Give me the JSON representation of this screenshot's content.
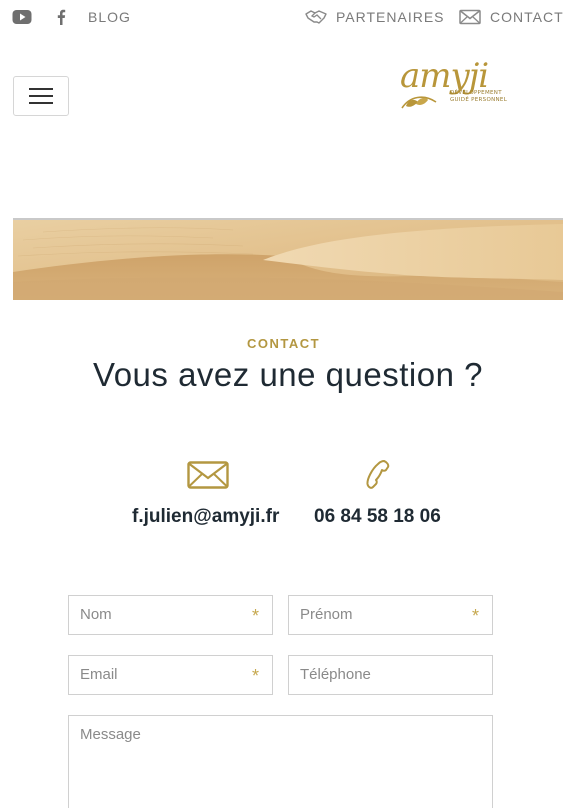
{
  "topbar": {
    "youtube_icon": "youtube-icon",
    "facebook_icon": "facebook-icon",
    "blog_label": "BLOG",
    "partners_icon": "handshake-icon",
    "partners_label": "PARTENAIRES",
    "contact_icon": "envelope-icon",
    "contact_label": "CONTACT"
  },
  "header": {
    "menu_icon": "hamburger-icon",
    "logo": {
      "word": "amyji",
      "line1": "Développement",
      "line2": "Guidé Personnel"
    }
  },
  "section": {
    "eyebrow": "CONTACT",
    "title": "Vous avez une question ?"
  },
  "contact": {
    "email": "f.julien@amyji.fr",
    "phone": "06 84 58 18 06",
    "email_icon": "envelope-icon",
    "phone_icon": "phone-icon"
  },
  "form": {
    "nom_placeholder": "Nom",
    "prenom_placeholder": "Prénom",
    "email_placeholder": "Email",
    "telephone_placeholder": "Téléphone",
    "message_placeholder": "Message",
    "required_mark": "*"
  },
  "colors": {
    "accent_gold": "#b39741",
    "text_dark": "#1f2a33",
    "muted_gray": "#7a7a7a"
  }
}
